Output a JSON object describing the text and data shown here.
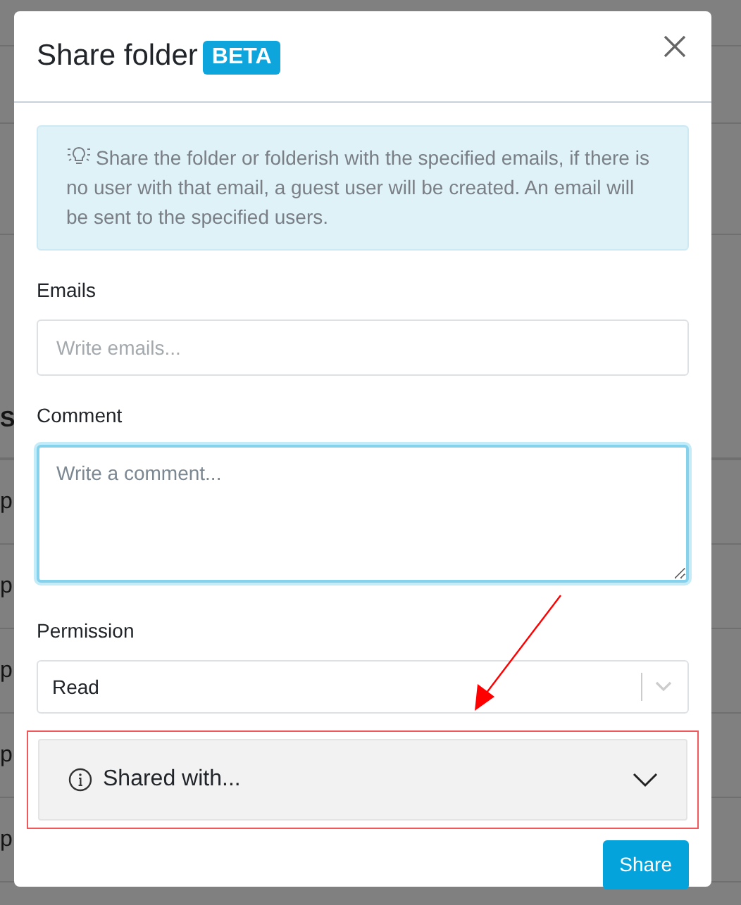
{
  "background": {
    "heading": "S",
    "rows": [
      "p",
      "p",
      "p",
      "p",
      "p"
    ]
  },
  "modal": {
    "title": "Share folder",
    "badge": "BETA",
    "alert": "Share the folder or folderish with the specified emails, if there is no user with that email, a guest user will be created. An email will be sent to the specified users.",
    "fields": [
      {
        "kind": "input",
        "label": "Emails",
        "placeholder": "Write emails...",
        "focused": false
      },
      {
        "kind": "textarea",
        "label": "Comment",
        "placeholder": "Write a comment...",
        "focused": true
      },
      {
        "kind": "select",
        "label": "Permission",
        "value": "Read",
        "focused": false
      }
    ],
    "accordion": {
      "title": "Shared with...",
      "expanded": false,
      "highlighted": true
    },
    "button": "Share"
  }
}
